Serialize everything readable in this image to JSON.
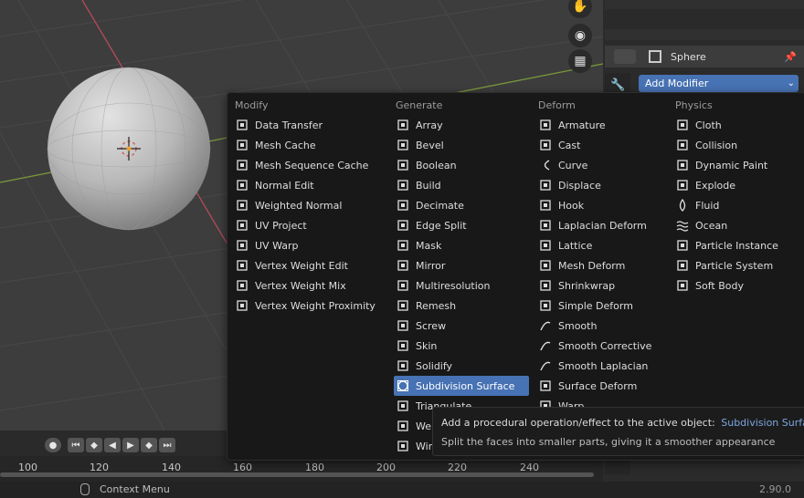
{
  "viewport": {
    "nav_icons": [
      "hand-icon",
      "camera-icon",
      "grid-icon"
    ]
  },
  "properties": {
    "object_name": "Sphere",
    "dropdown_label": "Add Modifier"
  },
  "menu": {
    "columns": [
      {
        "title": "Modify",
        "items": [
          {
            "label": "Data Transfer",
            "icon": "data-transfer-icon"
          },
          {
            "label": "Mesh Cache",
            "icon": "mesh-cache-icon"
          },
          {
            "label": "Mesh Sequence Cache",
            "icon": "mesh-sequence-cache-icon"
          },
          {
            "label": "Normal Edit",
            "icon": "normal-edit-icon"
          },
          {
            "label": "Weighted Normal",
            "icon": "weighted-normal-icon"
          },
          {
            "label": "UV Project",
            "icon": "uv-project-icon"
          },
          {
            "label": "UV Warp",
            "icon": "uv-warp-icon"
          },
          {
            "label": "Vertex Weight Edit",
            "icon": "vertex-weight-icon"
          },
          {
            "label": "Vertex Weight Mix",
            "icon": "vertex-weight-icon"
          },
          {
            "label": "Vertex Weight Proximity",
            "icon": "vertex-weight-icon"
          }
        ]
      },
      {
        "title": "Generate",
        "items": [
          {
            "label": "Array",
            "icon": "array-icon"
          },
          {
            "label": "Bevel",
            "icon": "bevel-icon"
          },
          {
            "label": "Boolean",
            "icon": "boolean-icon"
          },
          {
            "label": "Build",
            "icon": "build-icon"
          },
          {
            "label": "Decimate",
            "icon": "decimate-icon"
          },
          {
            "label": "Edge Split",
            "icon": "edge-split-icon"
          },
          {
            "label": "Mask",
            "icon": "mask-icon"
          },
          {
            "label": "Mirror",
            "icon": "mirror-icon"
          },
          {
            "label": "Multiresolution",
            "icon": "multires-icon"
          },
          {
            "label": "Remesh",
            "icon": "remesh-icon"
          },
          {
            "label": "Screw",
            "icon": "screw-icon"
          },
          {
            "label": "Skin",
            "icon": "skin-icon"
          },
          {
            "label": "Solidify",
            "icon": "solidify-icon"
          },
          {
            "label": "Subdivision Surface",
            "icon": "subsurf-icon",
            "highlighted": true
          },
          {
            "label": "Triangulate",
            "icon": "triangulate-icon"
          },
          {
            "label": "Weld",
            "icon": "weld-icon"
          },
          {
            "label": "Wireframe",
            "icon": "wireframe-icon"
          }
        ]
      },
      {
        "title": "Deform",
        "items": [
          {
            "label": "Armature",
            "icon": "armature-icon"
          },
          {
            "label": "Cast",
            "icon": "cast-icon"
          },
          {
            "label": "Curve",
            "icon": "curve-icon"
          },
          {
            "label": "Displace",
            "icon": "displace-icon"
          },
          {
            "label": "Hook",
            "icon": "hook-icon"
          },
          {
            "label": "Laplacian Deform",
            "icon": "laplacian-icon"
          },
          {
            "label": "Lattice",
            "icon": "lattice-icon"
          },
          {
            "label": "Mesh Deform",
            "icon": "mesh-deform-icon"
          },
          {
            "label": "Shrinkwrap",
            "icon": "shrinkwrap-icon"
          },
          {
            "label": "Simple Deform",
            "icon": "simple-deform-icon"
          },
          {
            "label": "Smooth",
            "icon": "smooth-icon"
          },
          {
            "label": "Smooth Corrective",
            "icon": "smooth-icon"
          },
          {
            "label": "Smooth Laplacian",
            "icon": "smooth-icon"
          },
          {
            "label": "Surface Deform",
            "icon": "surface-deform-icon"
          },
          {
            "label": "Warp",
            "icon": "warp-icon"
          }
        ]
      },
      {
        "title": "Physics",
        "items": [
          {
            "label": "Cloth",
            "icon": "cloth-icon"
          },
          {
            "label": "Collision",
            "icon": "collision-icon"
          },
          {
            "label": "Dynamic Paint",
            "icon": "dynamic-paint-icon"
          },
          {
            "label": "Explode",
            "icon": "explode-icon"
          },
          {
            "label": "Fluid",
            "icon": "fluid-icon"
          },
          {
            "label": "Ocean",
            "icon": "ocean-icon"
          },
          {
            "label": "Particle Instance",
            "icon": "particle-instance-icon"
          },
          {
            "label": "Particle System",
            "icon": "particle-system-icon"
          },
          {
            "label": "Soft Body",
            "icon": "soft-body-icon"
          }
        ]
      }
    ]
  },
  "tooltip": {
    "line1_prefix": "Add a procedural operation/effect to the active object:",
    "line1_value": "Subdivision Surface",
    "line2": "Split the faces into smaller parts, giving it a smoother appearance"
  },
  "timeline": {
    "ticks": [
      "100",
      "120",
      "140",
      "160",
      "180",
      "200",
      "220",
      "240"
    ]
  },
  "status": {
    "left": "Context Menu",
    "version": "2.90.0"
  },
  "colors": {
    "highlight": "#4772b3",
    "tooltip_value": "#7ea6e0",
    "x_axis": "#b54a5a",
    "y_axis": "#7a9a3a"
  }
}
